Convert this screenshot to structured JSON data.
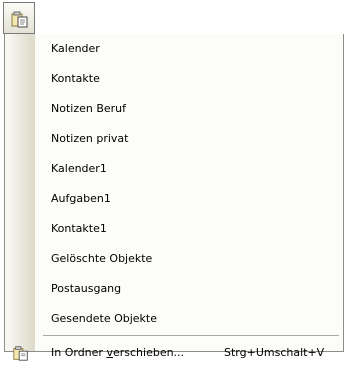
{
  "toolbar": {
    "button_icon": "move-to-folder-icon"
  },
  "menu": {
    "folders": [
      {
        "label": "Kalender"
      },
      {
        "label": "Kontakte"
      },
      {
        "label": "Notizen Beruf"
      },
      {
        "label": "Notizen privat"
      },
      {
        "label": "Kalender1"
      },
      {
        "label": "Aufgaben1"
      },
      {
        "label": "Kontakte1"
      },
      {
        "label": "Gelöschte Objekte"
      },
      {
        "label": "Postausgang"
      },
      {
        "label": "Gesendete Objekte"
      }
    ],
    "move": {
      "label_before": "In Ordner ",
      "label_underlined": "v",
      "label_after": "erschieben...",
      "shortcut": "Strg+Umschalt+V",
      "icon": "move-to-folder-icon"
    }
  }
}
